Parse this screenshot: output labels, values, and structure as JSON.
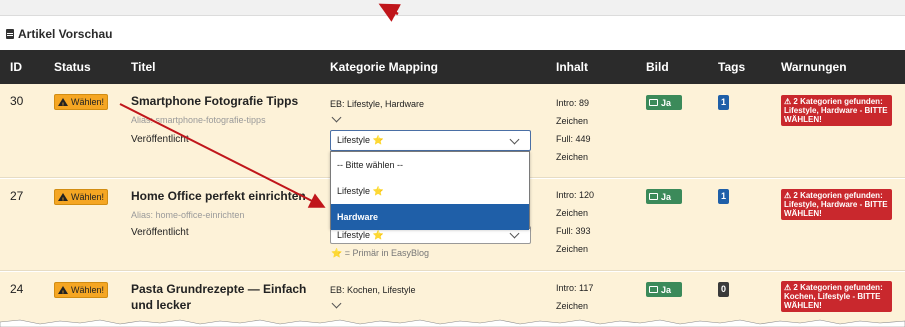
{
  "panel_title": "Artikel Vorschau",
  "columns": [
    "ID",
    "Status",
    "Titel",
    "Kategorie Mapping",
    "Inhalt",
    "Bild",
    "Tags",
    "Warnungen"
  ],
  "rows": [
    {
      "id": "30",
      "status": "Wählen!",
      "title": "Smartphone Fotografie Tipps",
      "alias": "Alias: smartphone-fotografie-tipps",
      "state": "Veröffentlicht",
      "eb": "EB: Lifestyle, Hardware",
      "inhalt_intro": "Intro: 89",
      "inhalt_intro_unit": "Zeichen",
      "inhalt_full": "Full: 449",
      "inhalt_full_unit": "Zeichen",
      "bild": "Ja",
      "tags": "1",
      "warning": "⚠ 2 Kategorien gefunden: Lifestyle, Hardware - BITTE WÄHLEN!"
    },
    {
      "id": "27",
      "status": "Wählen!",
      "title": "Home Office perfekt einrichten",
      "alias": "Alias: home-office-einrichten",
      "state": "Veröffentlicht",
      "eb": "",
      "inhalt_intro": "Intro: 120",
      "inhalt_intro_unit": "Zeichen",
      "inhalt_full": "Full: 393",
      "inhalt_full_unit": "Zeichen",
      "bild": "Ja",
      "tags": "1",
      "warning": "⚠ 2 Kategorien gefunden: Lifestyle, Hardware - BITTE WÄHLEN!"
    },
    {
      "id": "24",
      "status": "Wählen!",
      "title": "Pasta Grundrezepte — Einfach und lecker",
      "alias": "",
      "state": "",
      "eb": "EB: Kochen, Lifestyle",
      "inhalt_intro": "Intro: 117",
      "inhalt_intro_unit": "Zeichen",
      "inhalt_full": "",
      "inhalt_full_unit": "",
      "bild": "Ja",
      "tags": "0",
      "warning": "⚠ 2 Kategorien gefunden: Kochen, Lifestyle - BITTE WÄHLEN!"
    }
  ],
  "select_row1_value": "Lifestyle ⭐",
  "select_row2_value": "Lifestyle ⭐",
  "dropdown_options": [
    "-- Bitte wählen --",
    "Lifestyle ⭐",
    "Hardware"
  ],
  "dropdown_selected_index": 2,
  "legend": "⭐ = Primär in EasyBlog",
  "colors": {
    "header_bg": "#2b2b2b",
    "row_bg": "#fdf2d8",
    "warn_badge": "#f5a623",
    "error_bg": "#c9282d",
    "image_badge": "#3b8a5a",
    "tag_blue": "#1f5fa8",
    "tag_dark": "#3a3a3a",
    "annotation_arrow": "#c0161b"
  },
  "icons": {
    "panel": "document-icon",
    "status": "warning-triangle-icon",
    "bild": "image-icon",
    "select": "chevron-down-icon"
  }
}
